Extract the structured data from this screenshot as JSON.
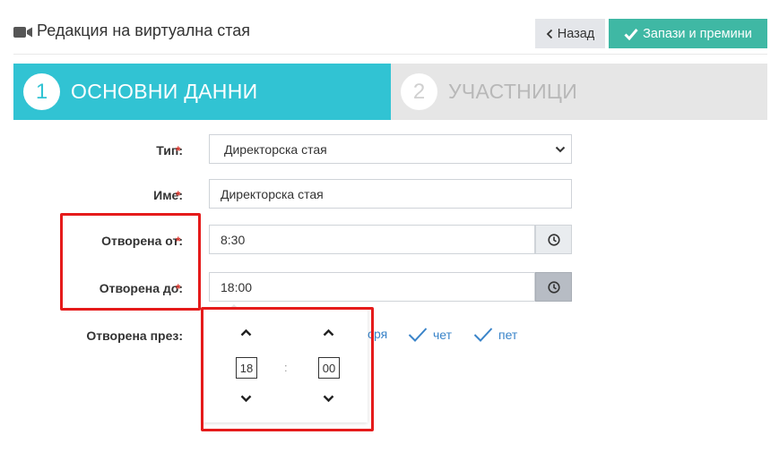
{
  "header": {
    "title": "Редакция на виртуална стая",
    "icon": "video-camera-icon",
    "back_label": "Назад",
    "save_label": "Запази и премини"
  },
  "steps": [
    {
      "number": "1",
      "label": "ОСНОВНИ ДАННИ",
      "active": true
    },
    {
      "number": "2",
      "label": "УЧАСТНИЦИ",
      "active": false
    }
  ],
  "form": {
    "type": {
      "label": "Тип:",
      "required": "*",
      "value": "Директорска стая"
    },
    "name": {
      "label": "Име:",
      "required": "*",
      "value": "Директорска стая"
    },
    "open_from": {
      "label": "Отворена от:",
      "required": "*",
      "value": "8:30"
    },
    "open_to": {
      "label": "Отворена до:",
      "required": "*",
      "value": "18:00"
    },
    "open_through": {
      "label": "Отворена през:"
    }
  },
  "days": [
    {
      "label": "сря",
      "checked": false
    },
    {
      "label": "чет",
      "checked": true
    },
    {
      "label": "пет",
      "checked": true
    }
  ],
  "time_picker": {
    "hours": "18",
    "minutes": "00",
    "separator": ":"
  },
  "colors": {
    "accent": "#31c3d3",
    "save": "#3fb8a4",
    "required": "#d9342b",
    "highlight": "#e51b1b",
    "link": "#3a84c9"
  }
}
